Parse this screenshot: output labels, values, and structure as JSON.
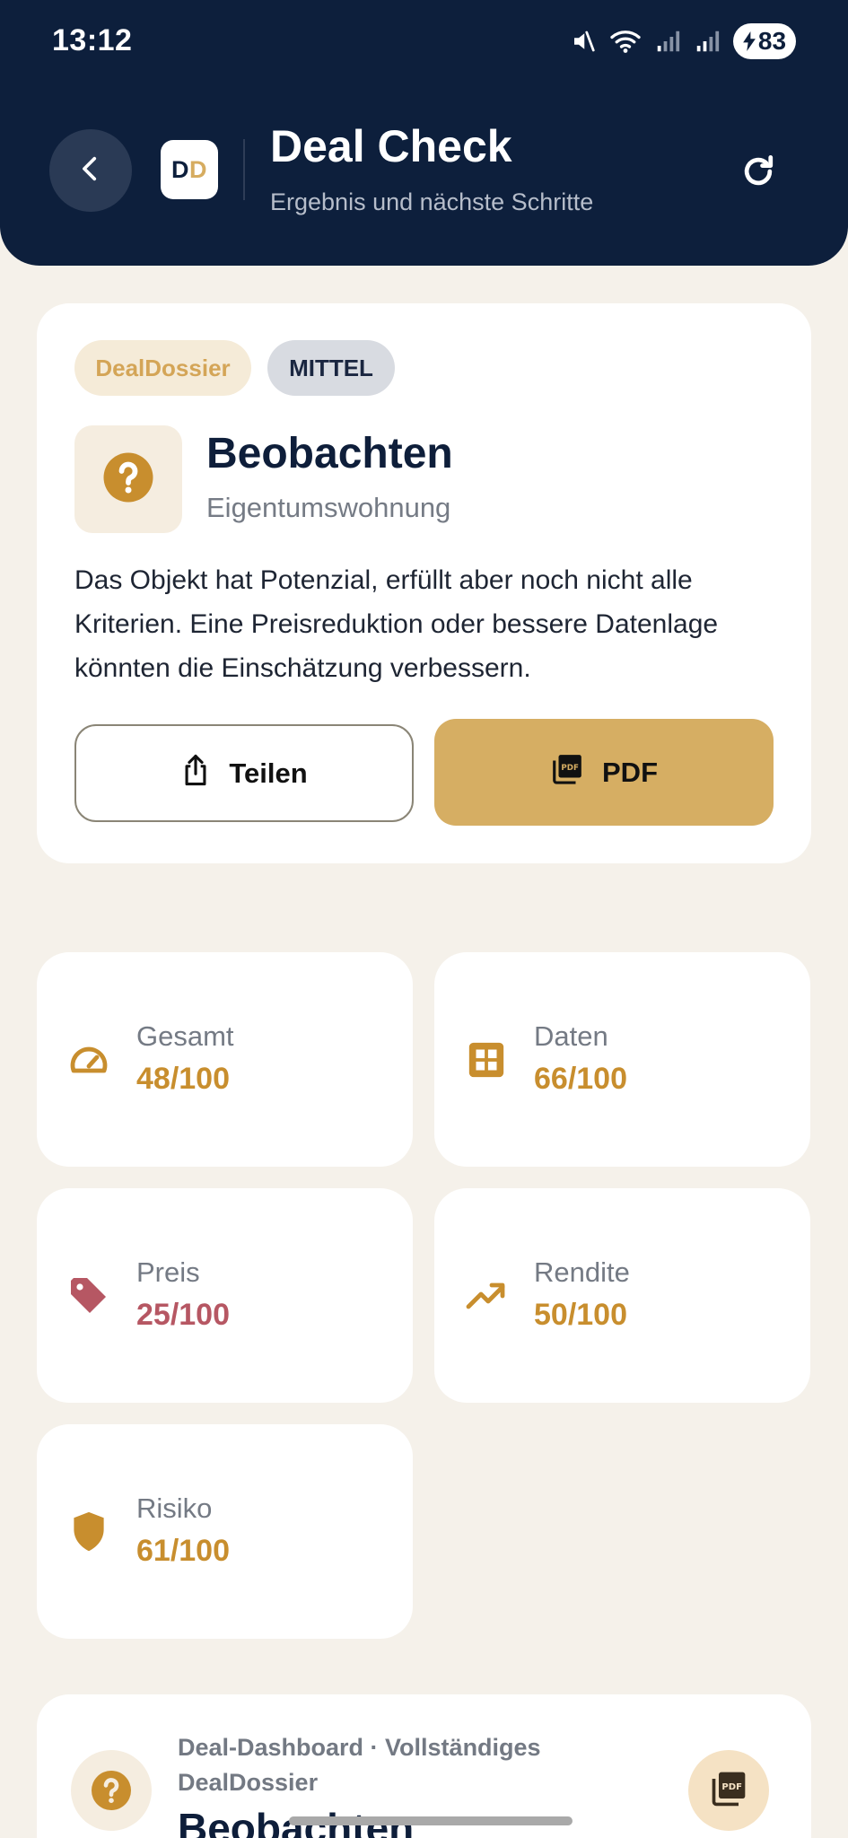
{
  "status_bar": {
    "time": "13:12",
    "battery": "83",
    "icons": [
      "mute-icon",
      "wifi-icon",
      "signal-icon",
      "signal-icon",
      "battery-charging-icon"
    ]
  },
  "header": {
    "logo_d1": "D",
    "logo_d2": "D",
    "title": "Deal Check",
    "subtitle": "Ergebnis und nächste Schritte",
    "back_icon": "chevron-left-icon",
    "refresh_icon": "refresh-icon"
  },
  "result": {
    "brand_chip": "DealDossier",
    "risk_chip": "MITTEL",
    "verdict_icon": "question-icon",
    "verdict": "Beobachten",
    "property_type": "Eigentumswohnung",
    "description": "Das Objekt hat Potenzial, erfüllt aber noch nicht alle Kriterien. Eine Preisreduktion oder bessere Datenlage könnten die Einschätzung verbessern.",
    "share_label": "Teilen",
    "pdf_label": "PDF"
  },
  "scores": [
    {
      "label": "Gesamt",
      "value": "48/100",
      "icon": "gauge-icon",
      "color": "#C88E2E"
    },
    {
      "label": "Daten",
      "value": "66/100",
      "icon": "grid-icon",
      "color": "#C88E2E"
    },
    {
      "label": "Preis",
      "value": "25/100",
      "icon": "tag-icon",
      "color": "#B65763"
    },
    {
      "label": "Rendite",
      "value": "50/100",
      "icon": "trending-up-icon",
      "color": "#C88E2E"
    },
    {
      "label": "Risiko",
      "value": "61/100",
      "icon": "shield-icon",
      "color": "#C88E2E"
    }
  ],
  "dashboard": {
    "subtitle": "Deal-Dashboard · Vollständiges DealDossier",
    "title": "Beobachten"
  },
  "colors": {
    "header_bg": "#0D1F3C",
    "page_bg": "#F5F1EA",
    "accent_gold": "#D6AE63",
    "score_gold": "#C88E2E",
    "score_red": "#B65763"
  }
}
